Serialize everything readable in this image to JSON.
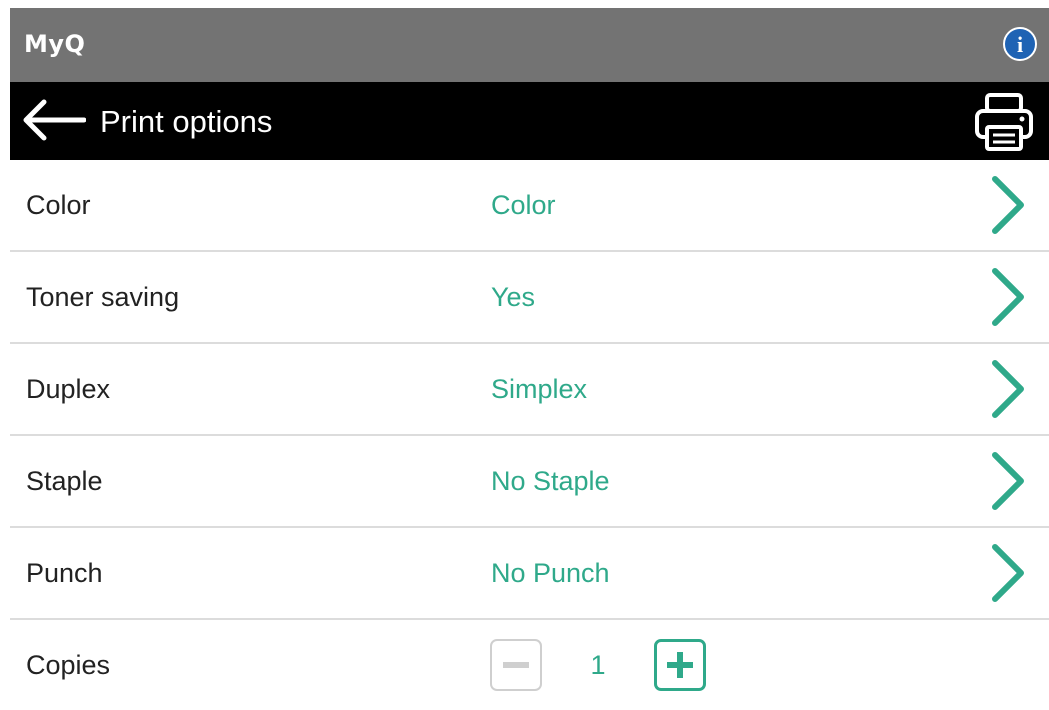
{
  "app": {
    "title": "MyQ",
    "info_icon": "info-icon",
    "info_glyph": "i"
  },
  "header": {
    "title": "Print options",
    "back_icon": "arrow-left-icon",
    "print_icon": "printer-icon"
  },
  "colors": {
    "topbar": "#737373",
    "titlebar": "#000000",
    "accent": "#2fa98a",
    "info": "#1f63b4",
    "divider": "#dcdcdc",
    "disabled": "#cfcfcf"
  },
  "options": [
    {
      "label": "Color",
      "value": "Color",
      "icon": "chevron-right-icon"
    },
    {
      "label": "Toner saving",
      "value": "Yes",
      "icon": "chevron-right-icon"
    },
    {
      "label": "Duplex",
      "value": "Simplex",
      "icon": "chevron-right-icon"
    },
    {
      "label": "Staple",
      "value": "No Staple",
      "icon": "chevron-right-icon"
    },
    {
      "label": "Punch",
      "value": "No Punch",
      "icon": "chevron-right-icon"
    }
  ],
  "copies": {
    "label": "Copies",
    "value": "1",
    "decrement_enabled": false,
    "increment_enabled": true
  }
}
